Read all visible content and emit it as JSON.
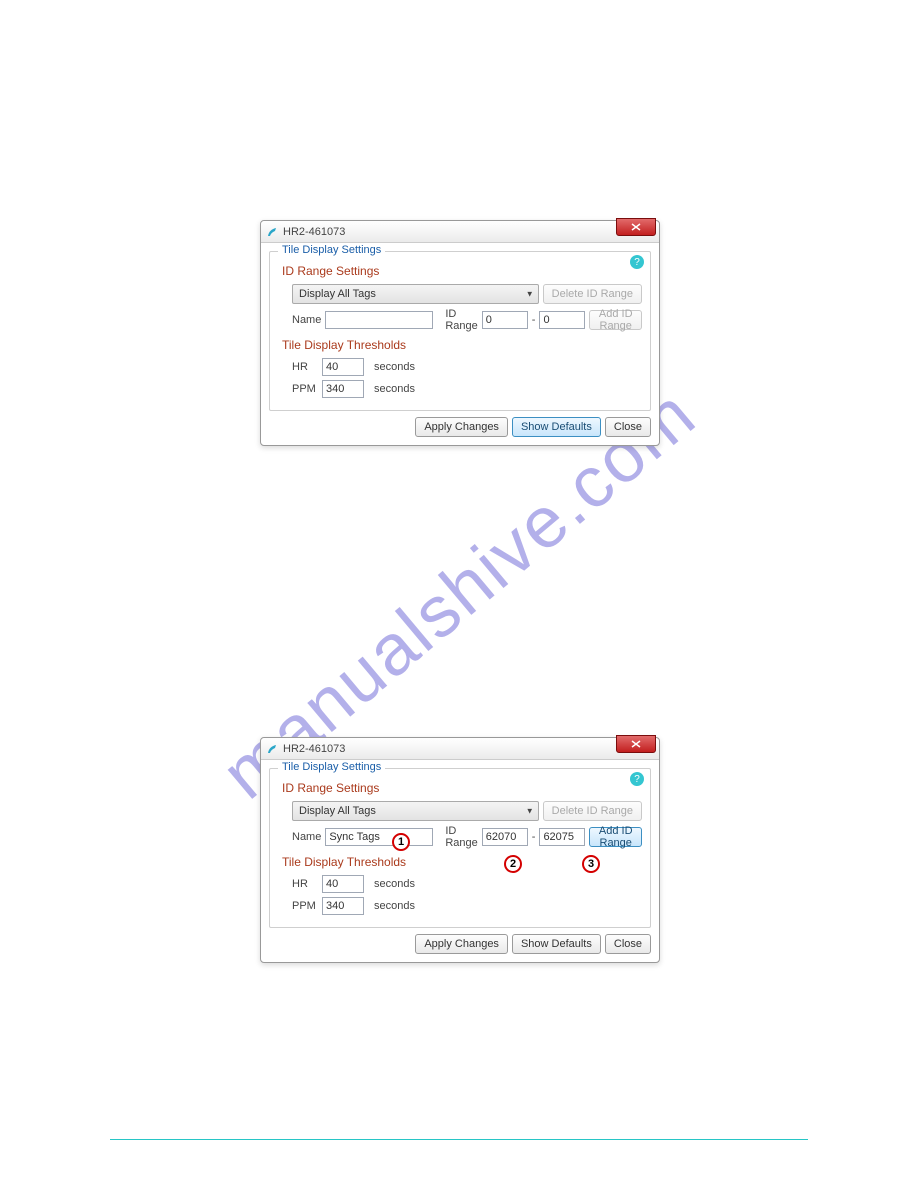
{
  "watermark": "manualshive.com",
  "dialog1": {
    "title": "HR2-461073",
    "help": "?",
    "fieldset_legend": "Tile Display Settings",
    "id_range_title": "ID Range Settings",
    "combo_value": "Display All Tags",
    "delete_btn": "Delete ID Range",
    "name_label": "Name",
    "name_value": "",
    "idrange_label": "ID Range",
    "range_from": "0",
    "range_dash": "-",
    "range_to": "0",
    "add_btn": "Add ID Range",
    "thresholds_title": "Tile Display Thresholds",
    "hr_label": "HR",
    "hr_value": "40",
    "hr_unit": "seconds",
    "ppm_label": "PPM",
    "ppm_value": "340",
    "ppm_unit": "seconds",
    "apply_btn": "Apply Changes",
    "defaults_btn": "Show Defaults",
    "close_btn": "Close"
  },
  "dialog2": {
    "title": "HR2-461073",
    "help": "?",
    "fieldset_legend": "Tile Display Settings",
    "id_range_title": "ID Range Settings",
    "combo_value": "Display All Tags",
    "delete_btn": "Delete ID Range",
    "name_label": "Name",
    "name_value": "Sync Tags",
    "idrange_label": "ID Range",
    "range_from": "62070",
    "range_dash": "-",
    "range_to": "62075",
    "add_btn": "Add ID Range",
    "thresholds_title": "Tile Display Thresholds",
    "hr_label": "HR",
    "hr_value": "40",
    "hr_unit": "seconds",
    "ppm_label": "PPM",
    "ppm_value": "340",
    "ppm_unit": "seconds",
    "apply_btn": "Apply Changes",
    "defaults_btn": "Show Defaults",
    "close_btn": "Close"
  },
  "callouts": {
    "c1": "1",
    "c2": "2",
    "c3": "3"
  }
}
